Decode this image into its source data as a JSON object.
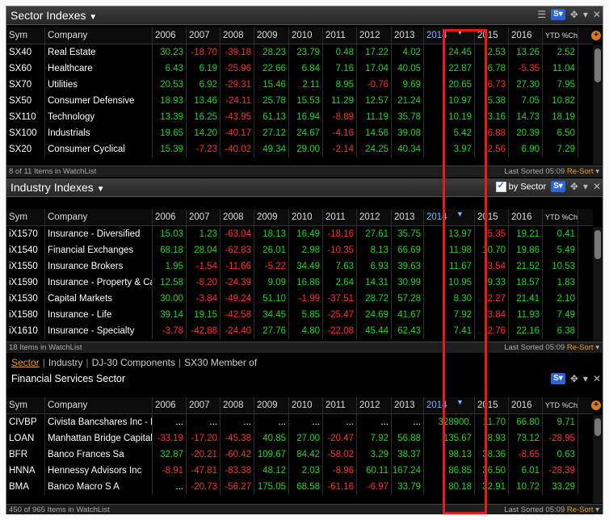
{
  "columns": [
    "Sym",
    "Company",
    "2006",
    "2007",
    "2008",
    "2009",
    "2010",
    "2011",
    "2012",
    "2013",
    "2014",
    "2015",
    "2016",
    "YTD %Chg"
  ],
  "highlight_column": "2014",
  "colors": {
    "positive": "#22d622",
    "negative": "#ff3030",
    "accent": "#e8a21c",
    "highlight_box": "#e81b1b",
    "header_highlight": "#7fb6ff"
  },
  "panels": [
    {
      "id": "sector",
      "title": "Sector Indexes",
      "title_dropdown": "▼",
      "has_ytd_plus": true,
      "footer_left": "8 of 11 Items in WatchList",
      "footer_sort": "Last Sorted 05:09",
      "footer_resort": "Re-Sort",
      "rows": [
        [
          "SX40",
          "Real Estate",
          "30.23",
          "-18.70",
          "-39.18",
          "28.23",
          "23.79",
          "0.48",
          "17.22",
          "4.02",
          "24.45",
          "2.53",
          "13.26",
          "2.52"
        ],
        [
          "SX60",
          "Healthcare",
          "6.43",
          "6.19",
          "-25.96",
          "22.66",
          "6.84",
          "7.16",
          "17.04",
          "40.05",
          "22.87",
          "6.78",
          "-5.35",
          "11.04"
        ],
        [
          "SX70",
          "Utilities",
          "20.53",
          "6.92",
          "-29.31",
          "15.46",
          "2.11",
          "8.95",
          "-0.76",
          "9.69",
          "20.65",
          "-6.73",
          "27.30",
          "7.95"
        ],
        [
          "SX50",
          "Consumer Defensive",
          "18.93",
          "13.46",
          "-24.11",
          "25.78",
          "15.53",
          "11.29",
          "12.57",
          "21.24",
          "10.97",
          "5.38",
          "7.05",
          "10.82"
        ],
        [
          "SX110",
          "Technology",
          "13.39",
          "16.25",
          "-43.95",
          "61.13",
          "16.94",
          "-8.89",
          "11.19",
          "35.78",
          "10.19",
          "3.16",
          "14.73",
          "18.19"
        ],
        [
          "SX100",
          "Industrials",
          "19.65",
          "14.20",
          "-40.17",
          "27.12",
          "24.67",
          "-4.16",
          "14.56",
          "39.08",
          "5.42",
          "-6.88",
          "20.39",
          "6.50"
        ],
        [
          "SX20",
          "Consumer Cyclical",
          "15.39",
          "-7.23",
          "-40.02",
          "49.34",
          "29.00",
          "-2.14",
          "24.25",
          "40.34",
          "3.97",
          "-2.56",
          "6.90",
          "7.29"
        ]
      ]
    },
    {
      "id": "industry",
      "title": "Industry Indexes",
      "title_dropdown": "▼",
      "by_sector_label": "by Sector",
      "has_ytd_plus": false,
      "footer_left": "18 Items in WatchList",
      "footer_sort": "Last Sorted 05:09",
      "footer_resort": "Re-Sort",
      "rows": [
        [
          "iX1570",
          "Insurance - Diversified",
          "15.03",
          "1.23",
          "-63.04",
          "18.13",
          "16.49",
          "-18.16",
          "27.61",
          "35.75",
          "13.97",
          "-5.35",
          "19.21",
          "0.41"
        ],
        [
          "iX1540",
          "Financial Exchanges",
          "68.18",
          "28.04",
          "-62.83",
          "26.01",
          "2.98",
          "-10.35",
          "8.13",
          "66.69",
          "11.98",
          "10.70",
          "19.86",
          "5.49"
        ],
        [
          "iX1550",
          "Insurance Brokers",
          "1.95",
          "-1.54",
          "-11.66",
          "-5.22",
          "34.49",
          "7.63",
          "6.93",
          "39.63",
          "11.67",
          "-3.54",
          "21.52",
          "10.53"
        ],
        [
          "iX1590",
          "Insurance - Property & Cas",
          "12.58",
          "-8.20",
          "-24.39",
          "9.09",
          "16.86",
          "2.64",
          "14.31",
          "30.99",
          "10.95",
          "9.33",
          "18.57",
          "1.83"
        ],
        [
          "iX1530",
          "Capital Markets",
          "30.00",
          "-3.84",
          "-49.24",
          "51.10",
          "-1.99",
          "-37.51",
          "28.72",
          "57.28",
          "8.30",
          "-2.27",
          "21.41",
          "2.10"
        ],
        [
          "iX1580",
          "Insurance - Life",
          "39.14",
          "19.15",
          "-42.58",
          "34.45",
          "5.85",
          "-25.47",
          "24.69",
          "41.67",
          "7.92",
          "-3.84",
          "11.93",
          "7.49"
        ],
        [
          "iX1610",
          "Insurance - Specialty",
          "-3.78",
          "-42.88",
          "-24.40",
          "27.76",
          "4.80",
          "-22.08",
          "45.44",
          "62.43",
          "7.41",
          "-2.76",
          "22.16",
          "6.38"
        ]
      ]
    },
    {
      "id": "financial",
      "tabs": [
        "Sector",
        "Industry",
        "DJ-30 Components",
        "SX30 Member of"
      ],
      "subtitle": "Financial Services Sector",
      "has_ytd_plus": true,
      "footer_left": "450 of 965 Items in WatchList",
      "footer_sort": "Last Sorted 05:09",
      "footer_resort": "Re-Sort",
      "rows": [
        [
          "CIVBP",
          "Civista Bancshares Inc - Pre",
          "...",
          "...",
          "...",
          "...",
          "...",
          "...",
          "...",
          "...",
          "328900.",
          "11.70",
          "66.80",
          "9.71"
        ],
        [
          "LOAN",
          "Manhattan Bridge Capital I",
          "-33.19",
          "-17.20",
          "-45.38",
          "40.85",
          "27.00",
          "-20.47",
          "7.92",
          "56.88",
          "135.67",
          "8.93",
          "73.12",
          "-28.95"
        ],
        [
          "BFR",
          "Banco Frances Sa",
          "32.87",
          "-20.21",
          "-60.42",
          "109.67",
          "84.42",
          "-58.02",
          "3.29",
          "38.37",
          "98.13",
          "38.36",
          "-8.65",
          "0.63"
        ],
        [
          "HNNA",
          "Hennessy Advisors Inc",
          "-8.91",
          "-47.81",
          "-83.38",
          "48.12",
          "2.03",
          "-8.96",
          "60.11",
          "167.24",
          "86.85",
          "36.50",
          "6.01",
          "-28.39"
        ],
        [
          "BMA",
          "Banco Macro S A",
          "...",
          "-20.73",
          "-56.27",
          "175.05",
          "68.58",
          "-61.16",
          "-6.97",
          "33.79",
          "80.18",
          "32.91",
          "10.72",
          "33.29"
        ]
      ]
    }
  ]
}
